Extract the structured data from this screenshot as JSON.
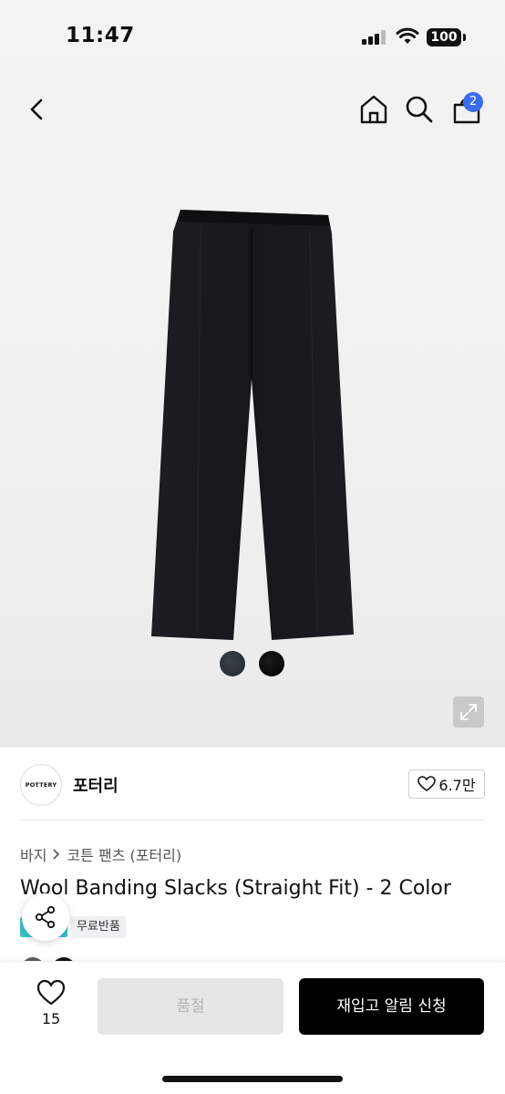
{
  "status_bar": {
    "time": "11:47",
    "battery": "100"
  },
  "nav": {
    "cart_count": "2"
  },
  "brand": {
    "logo_text": "POTTERY",
    "name": "포터리",
    "likes": "6.7만"
  },
  "breadcrumb": {
    "category": "바지",
    "subcategory": "코튼 팬츠 (포터리)"
  },
  "product": {
    "title": "Wool Banding Slacks (Straight Fit) - 2 Color",
    "badge": "무료반품",
    "colors": [
      "#2c3138",
      "#0a0a0a"
    ]
  },
  "bottom": {
    "wish_count": "15",
    "soldout_label": "품절",
    "restock_label": "재입고 알림 신청"
  }
}
